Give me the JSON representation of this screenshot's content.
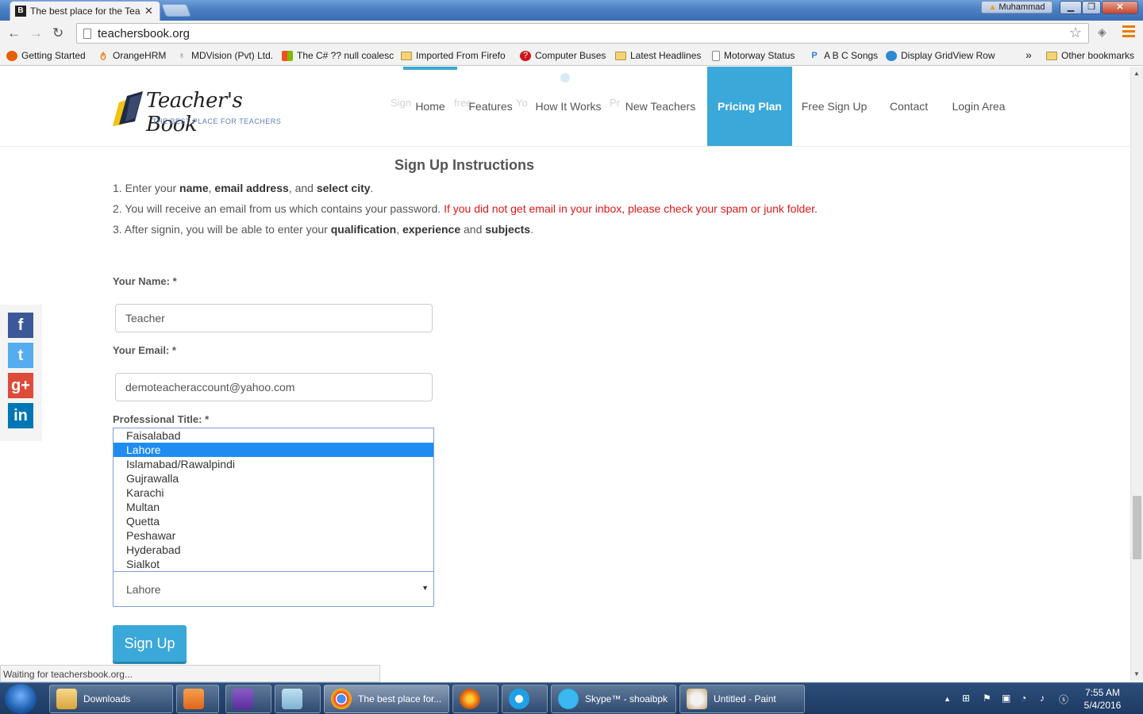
{
  "browser": {
    "tab_title": "The best place for the Tea",
    "tab_favicon": "B",
    "tab_close": "✕",
    "user_name": "Muhammad",
    "url": "teachersbook.org",
    "bookmarks": [
      {
        "label": "Getting Started",
        "icon": "firefox-icon"
      },
      {
        "label": "OrangeHRM",
        "icon": "orangehrm-icon"
      },
      {
        "label": "MDVision (Pvt) Ltd.",
        "icon": "mdvision-icon"
      },
      {
        "label": "The C# ?? null coalesc",
        "icon": "windows-icon"
      },
      {
        "label": "Imported From Firefo",
        "icon": "folder-icon"
      },
      {
        "label": "Computer Buses",
        "icon": "help-icon"
      },
      {
        "label": "Latest Headlines",
        "icon": "folder-icon"
      },
      {
        "label": "Motorway Status",
        "icon": "page-icon"
      },
      {
        "label": "A B C Songs",
        "icon": "p-icon"
      },
      {
        "label": "Display GridView Row",
        "icon": "asp-icon"
      }
    ],
    "more_bookmarks": "»",
    "other_bookmarks": "Other bookmarks",
    "status": "Waiting for teachersbook.org..."
  },
  "site": {
    "logo_name": "Teacher's Book",
    "logo_tagline": "THE BEST PLACE FOR TEACHERS",
    "nav": [
      {
        "label": "Home"
      },
      {
        "label": "Features"
      },
      {
        "label": "How It Works"
      },
      {
        "label": "New Teachers"
      },
      {
        "label": "Pricing Plan",
        "active": true
      },
      {
        "label": "Free Sign Up"
      },
      {
        "label": "Contact"
      },
      {
        "label": "Login Area"
      }
    ],
    "ghost_1": "Sign",
    "ghost_2": "free",
    "ghost_3": "Yo",
    "ghost_4": "Pr",
    "accent_color": "#3aa8d8"
  },
  "instructions": {
    "title": "Sign Up Instructions",
    "step1": {
      "a": "1. Enter your ",
      "b": "name",
      "c": ", ",
      "d": "email address",
      "e": ", and ",
      "f": "select city",
      "g": "."
    },
    "step2": {
      "a": "2. You will receive an email from us which contains your password. ",
      "warning": "If you did not get email in your inbox, please check your spam or junk folder."
    },
    "step3": {
      "a": "3. After signin, you will be able to enter your ",
      "b": "qualification",
      "c": ", ",
      "d": "experience",
      "e": " and ",
      "f": "subjects",
      "g": "."
    }
  },
  "form": {
    "name_label": "Your Name: *",
    "name_value": "Teacher",
    "email_label": "Your Email: *",
    "email_value": "demoteacheraccount@yahoo.com",
    "title_label": "Professional Title: *",
    "city_options": [
      "Faisalabad",
      "Lahore",
      "Islamabad/Rawalpindi",
      "Gujrawalla",
      "Karachi",
      "Multan",
      "Quetta",
      "Peshawar",
      "Hyderabad",
      "Sialkot"
    ],
    "city_selected": "Lahore",
    "submit_label": "Sign Up"
  },
  "social": [
    {
      "name": "facebook-icon",
      "glyph": "f",
      "color": "#3b5998"
    },
    {
      "name": "twitter-icon",
      "glyph": "t",
      "color": "#55acee"
    },
    {
      "name": "google-plus-icon",
      "glyph": "g+",
      "color": "#dd4b39"
    },
    {
      "name": "linkedin-icon",
      "glyph": "in",
      "color": "#0077b5"
    }
  ],
  "taskbar": {
    "items": [
      {
        "label": "Downloads",
        "icon": "folder-icon"
      },
      {
        "label": "",
        "icon": "media-player-icon"
      },
      {
        "label": "",
        "icon": "visual-studio-icon"
      },
      {
        "label": "",
        "icon": "notepad-icon"
      },
      {
        "label": "The best place for...",
        "icon": "chrome-icon"
      },
      {
        "label": "",
        "icon": "firefox-icon"
      },
      {
        "label": "",
        "icon": "ie-icon"
      },
      {
        "label": "Skype™ - shoaibpk",
        "icon": "skype-icon"
      },
      {
        "label": "Untitled - Paint",
        "icon": "paint-icon"
      }
    ],
    "time": "7:55 AM",
    "date": "5/4/2016"
  }
}
